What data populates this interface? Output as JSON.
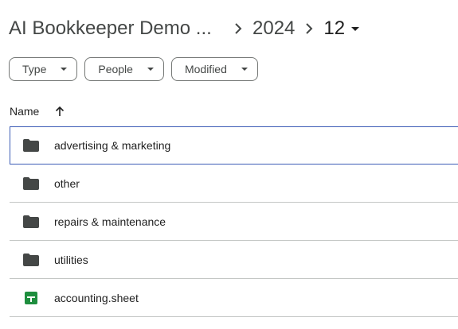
{
  "breadcrumb": {
    "root": "AI Bookkeeper Demo ...",
    "year": "2024",
    "month": "12"
  },
  "filters": [
    {
      "label": "Type"
    },
    {
      "label": "People"
    },
    {
      "label": "Modified"
    }
  ],
  "list_header": {
    "name_label": "Name",
    "sort": "ascending"
  },
  "items": [
    {
      "name": "advertising & marketing",
      "icon": "folder-icon",
      "selected": true
    },
    {
      "name": "other",
      "icon": "folder-icon",
      "selected": false
    },
    {
      "name": "repairs & maintenance",
      "icon": "folder-icon",
      "selected": false
    },
    {
      "name": "utilities",
      "icon": "folder-icon",
      "selected": false
    },
    {
      "name": "accounting.sheet",
      "icon": "spreadsheet-icon",
      "selected": false
    }
  ],
  "colors": {
    "folder": "#444746",
    "sheet": "#1e8e3e",
    "selected_border": "#3c5cb6",
    "divider": "#c4c7c5"
  }
}
